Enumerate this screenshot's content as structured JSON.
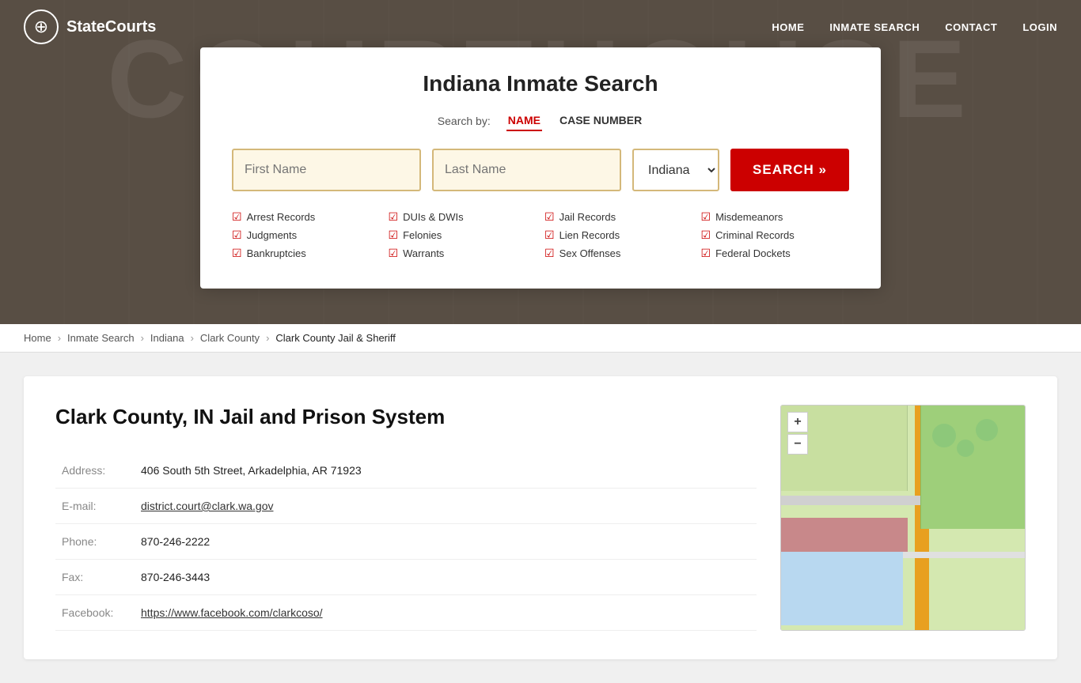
{
  "nav": {
    "logo_text": "StateCourts",
    "links": [
      {
        "label": "HOME",
        "href": "#"
      },
      {
        "label": "INMATE SEARCH",
        "href": "#"
      },
      {
        "label": "CONTACT",
        "href": "#"
      },
      {
        "label": "LOGIN",
        "href": "#"
      }
    ]
  },
  "hero_bg_text": "COURTHOUSE",
  "search": {
    "title": "Indiana Inmate Search",
    "search_by_label": "Search by:",
    "tab_name": "NAME",
    "tab_case": "CASE NUMBER",
    "first_name_placeholder": "First Name",
    "last_name_placeholder": "Last Name",
    "state_value": "Indiana",
    "search_button": "SEARCH »",
    "checkboxes": [
      "Arrest Records",
      "Judgments",
      "Bankruptcies",
      "DUIs & DWIs",
      "Felonies",
      "Warrants",
      "Jail Records",
      "Lien Records",
      "Sex Offenses",
      "Misdemeanors",
      "Criminal Records",
      "Federal Dockets"
    ]
  },
  "breadcrumb": {
    "items": [
      {
        "label": "Home",
        "href": "#"
      },
      {
        "label": "Inmate Search",
        "href": "#"
      },
      {
        "label": "Indiana",
        "href": "#"
      },
      {
        "label": "Clark County",
        "href": "#"
      },
      {
        "label": "Clark County Jail & Sheriff",
        "href": "#",
        "current": true
      }
    ]
  },
  "content": {
    "title": "Clark County, IN Jail and Prison System",
    "address_label": "Address:",
    "address_value": "406 South 5th Street, Arkadelphia, AR 71923",
    "email_label": "E-mail:",
    "email_value": "district.court@clark.wa.gov",
    "phone_label": "Phone:",
    "phone_value": "870-246-2222",
    "fax_label": "Fax:",
    "fax_value": "870-246-3443",
    "facebook_label": "Facebook:",
    "facebook_value": "https://www.facebook.com/clarkcoso/"
  },
  "map": {
    "plus": "+",
    "minus": "−"
  }
}
